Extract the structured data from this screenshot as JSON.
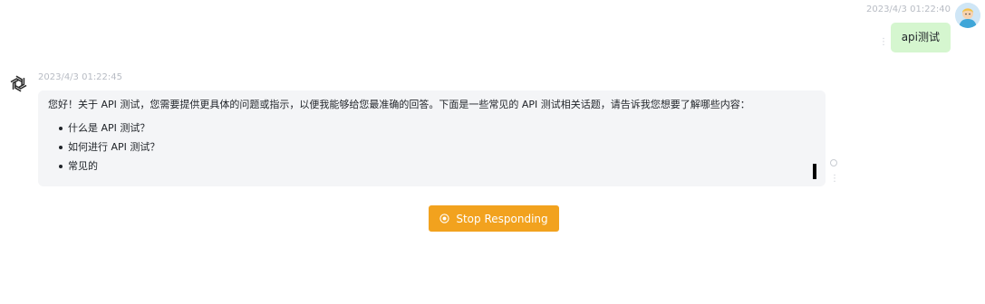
{
  "user_message": {
    "timestamp": "2023/4/3 01:22:40",
    "text": "api测试",
    "avatar_icon": "user-avatar-icon",
    "more_icon": "more-vertical-icon",
    "bubble_color": "#d5f6cf"
  },
  "assistant_message": {
    "timestamp": "2023/4/3 01:22:45",
    "avatar_icon": "openai-logo-icon",
    "intro": "您好！关于 API 测试，您需要提供更具体的问题或指示，以便我能够给您最准确的回答。下面是一些常见的 API 测试相关话题，请告诉我您想要了解哪些内容：",
    "list_items": [
      "什么是 API 测试？",
      "如何进行 API 测试？",
      "常见的"
    ],
    "streaming": true,
    "bubble_color": "#f4f5f7"
  },
  "stop_button": {
    "label": "Stop Responding",
    "icon": "stop-circle-icon",
    "color": "#f2a21e"
  }
}
